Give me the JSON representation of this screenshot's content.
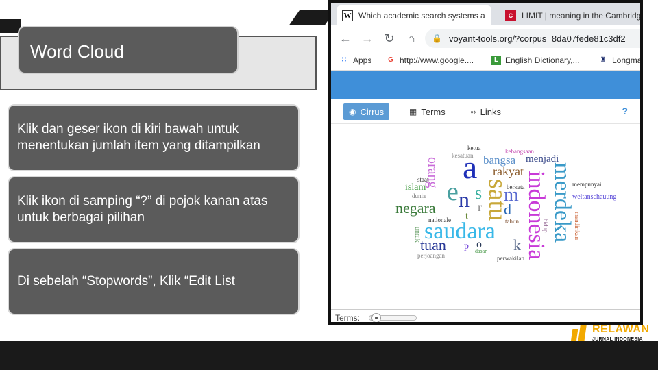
{
  "slide": {
    "title": "Word Cloud",
    "bullets": [
      "Klik dan geser ikon di kiri bawah untuk menentukan jumlah item yang ditampilkan",
      "Klik ikon di samping “?” di pojok kanan atas untuk berbagai pilihan",
      "Di sebelah “Stopwords”, Klik “Edit List"
    ]
  },
  "browser": {
    "tabs": [
      {
        "favicon": "W",
        "label": "Which academic search systems a"
      },
      {
        "favicon": "C",
        "label": "LIMIT | meaning in the Cambridge"
      }
    ],
    "url": "voyant-tools.org/?corpus=8da07fede81c3df2",
    "bookmarks": [
      {
        "icon": "apps-grid-icon",
        "label": "Apps"
      },
      {
        "icon": "google-icon",
        "label": "http://www.google...."
      },
      {
        "icon": "L",
        "label": "English Dictionary,..."
      },
      {
        "icon": "longman-icon",
        "label": "Longma"
      }
    ]
  },
  "voyant": {
    "tabs": [
      {
        "label": "Cirrus",
        "icon": "eye-icon",
        "active": true
      },
      {
        "label": "Terms",
        "icon": "table-icon",
        "active": false
      },
      {
        "label": "Links",
        "icon": "share-icon",
        "active": false
      }
    ],
    "help": "?",
    "terms_label": "Terms:",
    "terms_slider_fraction": 0.05
  },
  "word_cloud": {
    "words": [
      {
        "text": "ketua",
        "color": "#333333"
      },
      {
        "text": "kesatuan",
        "color": "#8a8a8a"
      },
      {
        "text": "kebangsaan",
        "color": "#c44bb0"
      },
      {
        "text": "bangsa",
        "color": "#5b8fc9"
      },
      {
        "text": "menjadi",
        "color": "#3a4a8a"
      },
      {
        "text": "staat",
        "color": "#333333"
      },
      {
        "text": "a",
        "color": "#1e2fb8"
      },
      {
        "text": "rakyat",
        "color": "#8a5a2a"
      },
      {
        "text": "islam",
        "color": "#4aa04a"
      },
      {
        "text": "dunia",
        "color": "#7a7a7a"
      },
      {
        "text": "orang",
        "color": "#c86ad8"
      },
      {
        "text": "e",
        "color": "#4aa0a0"
      },
      {
        "text": "n",
        "color": "#2a3aa8"
      },
      {
        "text": "s",
        "color": "#3ab0a0"
      },
      {
        "text": "satu",
        "color": "#c8a83a"
      },
      {
        "text": "m",
        "color": "#5a6ad0"
      },
      {
        "text": "berkata",
        "color": "#333333"
      },
      {
        "text": "indonesia",
        "color": "#c83ad8"
      },
      {
        "text": "merdeka",
        "color": "#3a9ac8"
      },
      {
        "text": "mempunyai",
        "color": "#333333"
      },
      {
        "text": "weltanschauung",
        "color": "#5a4ad8"
      },
      {
        "text": "negara",
        "color": "#3a7a3a"
      },
      {
        "text": "r",
        "color": "#8a8a8a"
      },
      {
        "text": "d",
        "color": "#2a6ab8"
      },
      {
        "text": "nationale",
        "color": "#333333"
      },
      {
        "text": "t",
        "color": "#6a8a3a"
      },
      {
        "text": "tahun",
        "color": "#7a4a2a"
      },
      {
        "text": "saudara",
        "color": "#38b8e8"
      },
      {
        "text": "k",
        "color": "#5a6a8a"
      },
      {
        "text": "untuk",
        "color": "#6aa06a"
      },
      {
        "text": "tuan",
        "color": "#2a3a98"
      },
      {
        "text": "p",
        "color": "#6a3ad8"
      },
      {
        "text": "o",
        "color": "#2a3a58"
      },
      {
        "text": "dasar",
        "color": "#4a9a4a"
      },
      {
        "text": "perjoangan",
        "color": "#8a8a8a"
      },
      {
        "text": "perwakilan",
        "color": "#555555"
      },
      {
        "text": "mendirikan",
        "color": "#c85a2a"
      },
      {
        "text": "hidup",
        "color": "#8a5a8a"
      }
    ]
  },
  "logo": {
    "name": "RELAWAN",
    "subtitle": "JURNAL INDONESIA",
    "color": "#f2a900"
  }
}
